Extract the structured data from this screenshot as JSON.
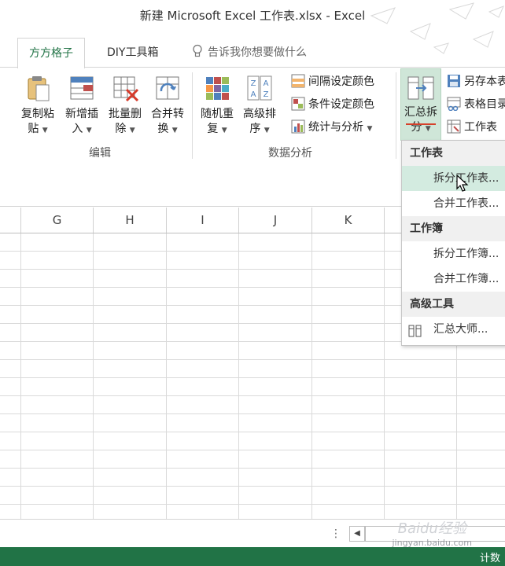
{
  "window": {
    "title": "新建 Microsoft Excel 工作表.xlsx - Excel"
  },
  "tabs": [
    {
      "label": "方方格子",
      "active": true
    },
    {
      "label": "DIY工具箱",
      "active": false
    }
  ],
  "tell_me": "告诉我你想要做什么",
  "ribbon": {
    "edit_group": {
      "label": "编辑",
      "buttons": [
        {
          "line1": "复制粘",
          "line2": "贴",
          "icon": "clipboard-icon"
        },
        {
          "line1": "新增插",
          "line2": "入",
          "icon": "insert-rows-icon"
        },
        {
          "line1": "批量删",
          "line2": "除",
          "icon": "batch-delete-icon"
        },
        {
          "line1": "合并转",
          "line2": "换",
          "icon": "merge-convert-icon"
        }
      ]
    },
    "data_group": {
      "label": "数据分析",
      "buttons": [
        {
          "line1": "随机重",
          "line2": "复",
          "icon": "random-repeat-icon"
        },
        {
          "line1": "高级排",
          "line2": "序",
          "icon": "advanced-sort-icon"
        }
      ],
      "small": [
        {
          "label": "间隔设定颜色",
          "icon": "interval-color-icon"
        },
        {
          "label": "条件设定颜色",
          "icon": "condition-color-icon"
        },
        {
          "label": "统计与分析",
          "icon": "statistics-icon"
        }
      ]
    },
    "summary_button": {
      "line1": "汇总拆",
      "line2": "分",
      "icon": "summary-split-icon"
    },
    "right_small": [
      {
        "label": "另存本表",
        "icon": "save-copy-icon"
      },
      {
        "label": "表格目录",
        "icon": "table-directory-icon"
      },
      {
        "label": "工作表",
        "icon": "worksheet-icon"
      }
    ]
  },
  "columns": [
    "G",
    "H",
    "I",
    "J",
    "K"
  ],
  "dropdown": {
    "sections": [
      {
        "header": "工作表",
        "items": [
          "拆分工作表...",
          "合并工作表..."
        ]
      },
      {
        "header": "工作簿",
        "items": [
          "拆分工作簿...",
          "合并工作簿..."
        ]
      },
      {
        "header": "高级工具",
        "items": [
          "汇总大师..."
        ]
      }
    ]
  },
  "status": {
    "right_text": "计数"
  },
  "watermark": {
    "brand": "Baidu经验",
    "url": "jingyan.baidu.com"
  },
  "colors": {
    "accent": "#217346",
    "hover": "#d3ebe0",
    "summary_bg": "#cfe6d8",
    "annotation": "#d6402a"
  }
}
